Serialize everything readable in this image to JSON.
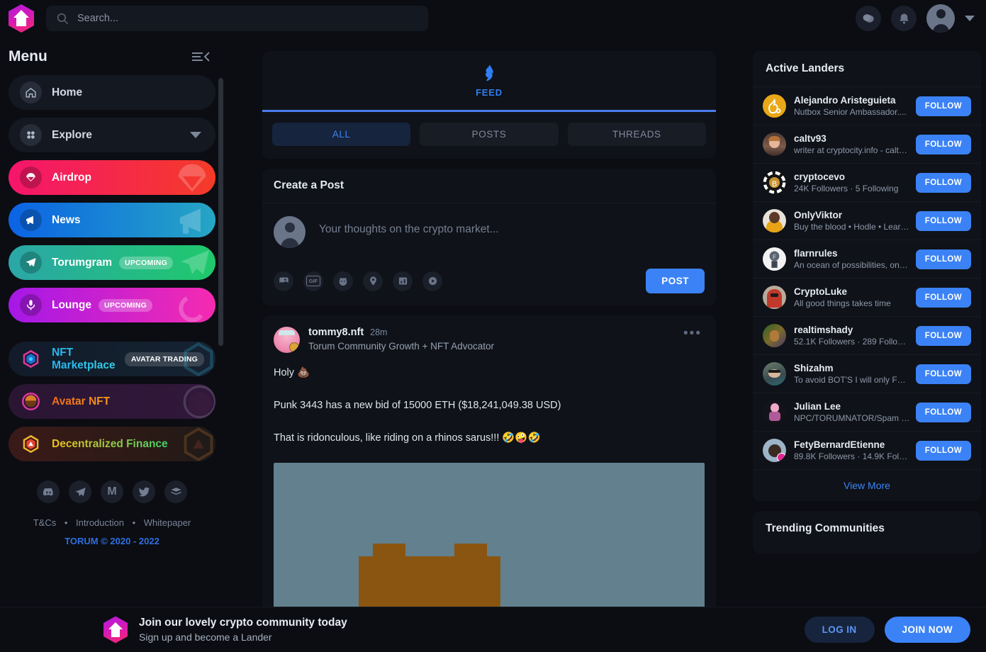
{
  "header": {
    "logo_icon": "torum-arrow-logo",
    "search": {
      "placeholder": "Search...",
      "value": "",
      "icon": "search-icon"
    },
    "actions": [
      {
        "icon": "chat-bubble-icon",
        "name": "messages-button"
      },
      {
        "icon": "bell-icon",
        "name": "notifications-button"
      },
      {
        "icon": "user-avatar-icon",
        "name": "profile-button"
      },
      {
        "icon": "chevron-down-icon",
        "name": "profile-dropdown-button"
      }
    ]
  },
  "sidebar": {
    "title": "Menu",
    "collapse_icon": "collapse-menu-icon",
    "items": [
      {
        "label": "Home",
        "icon": "home-icon",
        "style": "plain"
      },
      {
        "label": "Explore",
        "icon": "grid-icon",
        "style": "plain",
        "chevron": true
      },
      {
        "label": "Airdrop",
        "icon": "parachute-icon",
        "style": "gradient-red"
      },
      {
        "label": "News",
        "icon": "megaphone-icon",
        "style": "gradient-blue"
      },
      {
        "label": "Torumgram",
        "icon": "telegram-icon",
        "style": "gradient-green",
        "badge": "UPCOMING"
      },
      {
        "label": "Lounge",
        "icon": "microphone-icon",
        "style": "gradient-purple",
        "badge": "UPCOMING"
      },
      {
        "label": "NFT Marketplace",
        "icon": "hexagon-nft-icon",
        "style": "dark-cyan",
        "badge": "AVATAR TRADING"
      },
      {
        "label": "Avatar NFT",
        "icon": "avatar-ring-icon",
        "style": "dark-orange"
      },
      {
        "label": "Decentralized Finance",
        "icon": "hexagon-defi-icon",
        "style": "dark-defi"
      }
    ],
    "socials": [
      {
        "name": "discord-icon",
        "glyph": "●"
      },
      {
        "name": "telegram-icon",
        "glyph": "➤"
      },
      {
        "name": "medium-icon",
        "glyph": "M"
      },
      {
        "name": "twitter-icon",
        "glyph": "✈"
      },
      {
        "name": "gitbook-icon",
        "glyph": "≡"
      }
    ],
    "footer_links": [
      "T&Cs",
      "Introduction",
      "Whitepaper"
    ],
    "footer_separator": "•",
    "copyright": "TORUM © 2020 - 2022"
  },
  "feed": {
    "header_icon": "feed-icon",
    "header_label": "FEED",
    "tabs": [
      {
        "label": "ALL",
        "active": true
      },
      {
        "label": "POSTS",
        "active": false
      },
      {
        "label": "THREADS",
        "active": false
      }
    ]
  },
  "create_post": {
    "title": "Create a Post",
    "placeholder": "Your thoughts on the crypto market...",
    "value": "",
    "tools": [
      {
        "name": "image-icon",
        "glyph": "⛰"
      },
      {
        "name": "gif-icon",
        "glyph": "GIF"
      },
      {
        "name": "meme-icon",
        "glyph": "◑"
      },
      {
        "name": "location-icon",
        "glyph": "●"
      },
      {
        "name": "poll-icon",
        "glyph": "‖"
      },
      {
        "name": "video-icon",
        "glyph": "▶"
      }
    ],
    "submit_label": "POST"
  },
  "post": {
    "author": "tommy8.nft",
    "time": "28m",
    "bio": "Torum Community Growth + NFT Advocator",
    "more_icon": "more-options-icon",
    "lines": [
      "Holy 💩",
      "Punk 3443 has a new bid of 15000 ETH ($18,241,049.38 USD)",
      "That is ridonculous, like riding on a rhinos sarus!!! 🤣🤪🤣"
    ],
    "image": {
      "name": "post-pixel-art-image",
      "sky_color": "#63808f",
      "structure_color": "#8a5510"
    }
  },
  "right_panel": {
    "title": "Active Landers",
    "follow_label": "FOLLOW",
    "view_more_label": "View More",
    "trending_title": "Trending Communities",
    "landers": [
      {
        "name": "Alejandro Aristeguieta",
        "sub": "Nutbox Senior Ambassador....",
        "av_color": "#e9a817"
      },
      {
        "name": "caltv93",
        "sub": "writer at cryptocity.info - calt…",
        "av_color": "#6d4b45"
      },
      {
        "name": "cryptocevo",
        "sub": "24K Followers  ·  5 Following",
        "av_color": "#1c1c1c"
      },
      {
        "name": "OnlyViktor",
        "sub": "Buy the blood • Hodle • Lear…",
        "av_color": "#d8a23a"
      },
      {
        "name": "flarnrules",
        "sub": "An ocean of possibilities, on…",
        "av_color": "#e9e9e9"
      },
      {
        "name": "CryptoLuke",
        "sub": "All good things takes time",
        "av_color": "#8c4a40"
      },
      {
        "name": "realtimshady",
        "sub": "52.1K Followers  ·  289 Follo…",
        "av_color": "#3c5a36"
      },
      {
        "name": "Shizahm",
        "sub": "To avoid BOT'S I will only Fol…",
        "av_color": "#4d6b6e"
      },
      {
        "name": "Julian Lee",
        "sub": "NPC/TORUMNATOR/Spam …",
        "av_color": "#2a2330"
      },
      {
        "name": "FetyBernardEtienne",
        "sub": "89.8K Followers  ·  14.9K Fol…",
        "av_color": "#7d98b0"
      }
    ]
  },
  "banner": {
    "logo_icon": "torum-arrow-logo",
    "title": "Join our lovely crypto community today",
    "subtitle": "Sign up and become a Lander",
    "login_label": "LOG IN",
    "join_label": "JOIN NOW"
  },
  "colors": {
    "page_bg": "#0b0d12",
    "card_bg": "#0f1218",
    "accent_blue": "#3b82f6",
    "tab_active_bg": "#16243d",
    "tab_active_text": "#3d85f5"
  }
}
